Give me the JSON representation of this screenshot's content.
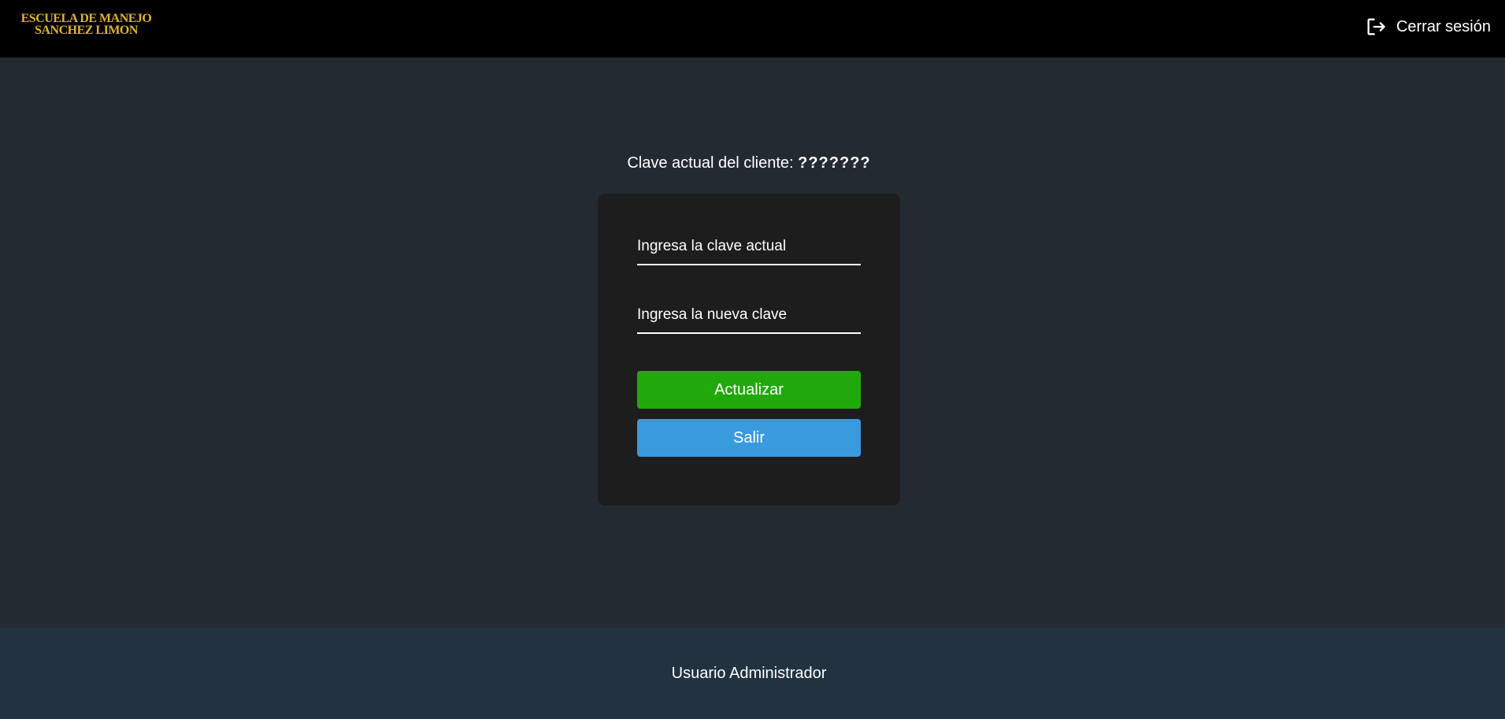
{
  "header": {
    "logo_line1": "ESCUELA DE MANEJO",
    "logo_line2": "SANCHEZ LIMON",
    "logout_label": "Cerrar sesión",
    "logout_icon": "logout-icon"
  },
  "main": {
    "client_key_label": "Clave actual del cliente:",
    "client_key_value": "???????"
  },
  "form": {
    "current_key_placeholder": "Ingresa la clave actual",
    "new_key_placeholder": "Ingresa la nueva clave",
    "update_label": "Actualizar",
    "exit_label": "Salir"
  },
  "footer": {
    "user_label": "Usuario Administrador"
  },
  "colors": {
    "header_bg": "#000000",
    "main_bg": "#232a32",
    "card_bg": "#1d1d1e",
    "logo": "#e0b22e",
    "update_button": "#21a90b",
    "exit_button": "#3a9ade",
    "footer_bg": "#223241"
  }
}
